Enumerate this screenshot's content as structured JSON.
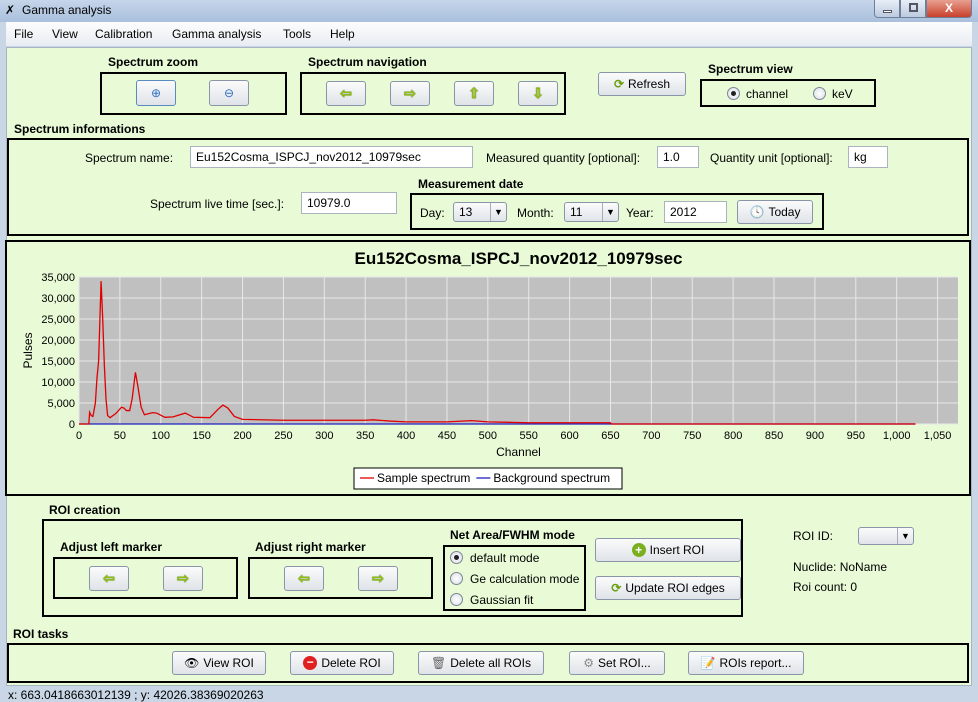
{
  "window": {
    "title": "Gamma analysis"
  },
  "menu": [
    "File",
    "View",
    "Calibration",
    "Gamma analysis",
    "Tools",
    "Help"
  ],
  "zoom": {
    "label": "Spectrum zoom"
  },
  "navigation": {
    "label": "Spectrum navigation"
  },
  "refresh": {
    "label": "Refresh"
  },
  "view": {
    "label": "Spectrum view",
    "options": [
      "channel",
      "keV"
    ],
    "selected": "channel"
  },
  "info": {
    "label": "Spectrum informations",
    "name_label": "Spectrum name:",
    "name_value": "Eu152Cosma_ISPCJ_nov2012_10979sec",
    "qty_label": "Measured quantity [optional]:",
    "qty_value": "1.0",
    "unit_label": "Quantity unit [optional]:",
    "unit_value": "kg",
    "live_label": "Spectrum live time [sec.]:",
    "live_value": "10979.0"
  },
  "date": {
    "label": "Measurement date",
    "day_label": "Day:",
    "day": "13",
    "month_label": "Month:",
    "month": "11",
    "year_label": "Year:",
    "year": "2012",
    "today": "Today"
  },
  "chart_data": {
    "type": "line",
    "title": "Eu152Cosma_ISPCJ_nov2012_10979sec",
    "xlabel": "Channel",
    "ylabel": "Pulses",
    "xlim": [
      0,
      1075
    ],
    "ylim": [
      0,
      35000
    ],
    "xticks": [
      "0",
      "50",
      "100",
      "150",
      "200",
      "250",
      "300",
      "350",
      "400",
      "450",
      "500",
      "550",
      "600",
      "650",
      "700",
      "750",
      "800",
      "850",
      "900",
      "950",
      "1,000",
      "1,050"
    ],
    "yticks": [
      "0",
      "5,000",
      "10,000",
      "15,000",
      "20,000",
      "25,000",
      "30,000",
      "35,000"
    ],
    "grid": true,
    "legend": "bottom",
    "series": [
      {
        "name": "Sample spectrum",
        "color": "#e00000",
        "points": [
          [
            0,
            0
          ],
          [
            12,
            0
          ],
          [
            13,
            2800
          ],
          [
            15,
            2000
          ],
          [
            17,
            1800
          ],
          [
            20,
            5000
          ],
          [
            22,
            11000
          ],
          [
            24,
            15000
          ],
          [
            27,
            34000
          ],
          [
            29,
            25000
          ],
          [
            31,
            14000
          ],
          [
            33,
            6000
          ],
          [
            35,
            2000
          ],
          [
            38,
            1500
          ],
          [
            45,
            2500
          ],
          [
            52,
            4000
          ],
          [
            55,
            3800
          ],
          [
            58,
            3200
          ],
          [
            62,
            3200
          ],
          [
            65,
            6000
          ],
          [
            69,
            12300
          ],
          [
            72,
            9000
          ],
          [
            76,
            4000
          ],
          [
            80,
            2200
          ],
          [
            90,
            2700
          ],
          [
            95,
            2600
          ],
          [
            105,
            1600
          ],
          [
            115,
            1700
          ],
          [
            130,
            2600
          ],
          [
            140,
            1600
          ],
          [
            160,
            1500
          ],
          [
            170,
            3500
          ],
          [
            176,
            4500
          ],
          [
            182,
            3800
          ],
          [
            190,
            1800
          ],
          [
            200,
            1100
          ],
          [
            250,
            900
          ],
          [
            350,
            900
          ],
          [
            360,
            1000
          ],
          [
            380,
            700
          ],
          [
            400,
            500
          ],
          [
            450,
            500
          ],
          [
            480,
            800
          ],
          [
            500,
            500
          ],
          [
            550,
            300
          ],
          [
            650,
            300
          ],
          [
            651,
            0
          ],
          [
            1023,
            0
          ]
        ]
      },
      {
        "name": "Background spectrum",
        "color": "#2020c0",
        "points": [
          [
            0,
            0
          ],
          [
            1023,
            0
          ]
        ]
      }
    ]
  },
  "roi": {
    "label": "ROI creation",
    "left_label": "Adjust left marker",
    "right_label": "Adjust right marker",
    "mode_label": "Net Area/FWHM mode",
    "modes": [
      "default mode",
      "Ge calculation mode",
      "Gaussian fit"
    ],
    "mode_selected": 0,
    "insert": "Insert ROI",
    "update": "Update ROI edges",
    "id_label": "ROI ID:",
    "id_value": "",
    "nuclide": "Nuclide: NoName",
    "count": "Roi count: 0"
  },
  "tasks": {
    "label": "ROI tasks",
    "buttons": [
      "View ROI",
      "Delete ROI",
      "Delete all ROIs",
      "Set ROI...",
      "ROIs report..."
    ]
  },
  "status": "x: 663.0418663012139 ; y: 42026.38369020263"
}
